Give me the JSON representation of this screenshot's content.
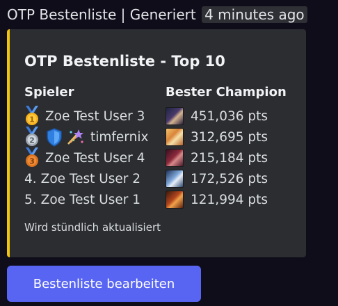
{
  "header": {
    "text": "OTP Bestenliste | Generiert",
    "timestamp": "4 minutes ago"
  },
  "embed": {
    "accent_color": "#f1c40f",
    "title": "OTP Bestenliste - Top 10",
    "col_player": "Spieler",
    "col_champion": "Bester Champion",
    "rows": [
      {
        "rank_icon": "gold-medal-icon",
        "rank_text": "",
        "name": "Zoe Test User 3",
        "champion_icon": "champion-portrait-icon",
        "score": "451,036 pts"
      },
      {
        "rank_icon": "silver-medal-icon",
        "rank_text": "",
        "name": "timfernix",
        "champion_icon": "champion-portrait-icon",
        "score": "312,695 pts"
      },
      {
        "rank_icon": "bronze-medal-icon",
        "rank_text": "",
        "name": "Zoe Test User 4",
        "champion_icon": "champion-portrait-icon",
        "score": "215,184 pts"
      },
      {
        "rank_icon": "",
        "rank_text": "4.",
        "name": "Zoe Test User 2",
        "champion_icon": "champion-portrait-icon",
        "score": "172,526 pts"
      },
      {
        "rank_icon": "",
        "rank_text": "5.",
        "name": "Zoe Test User 1",
        "champion_icon": "champion-portrait-icon",
        "score": "121,994 pts"
      }
    ],
    "footer": "Wird stündlich aktualisiert"
  },
  "button": {
    "label": "Bestenliste bearbeiten",
    "color": "#5865f2"
  }
}
